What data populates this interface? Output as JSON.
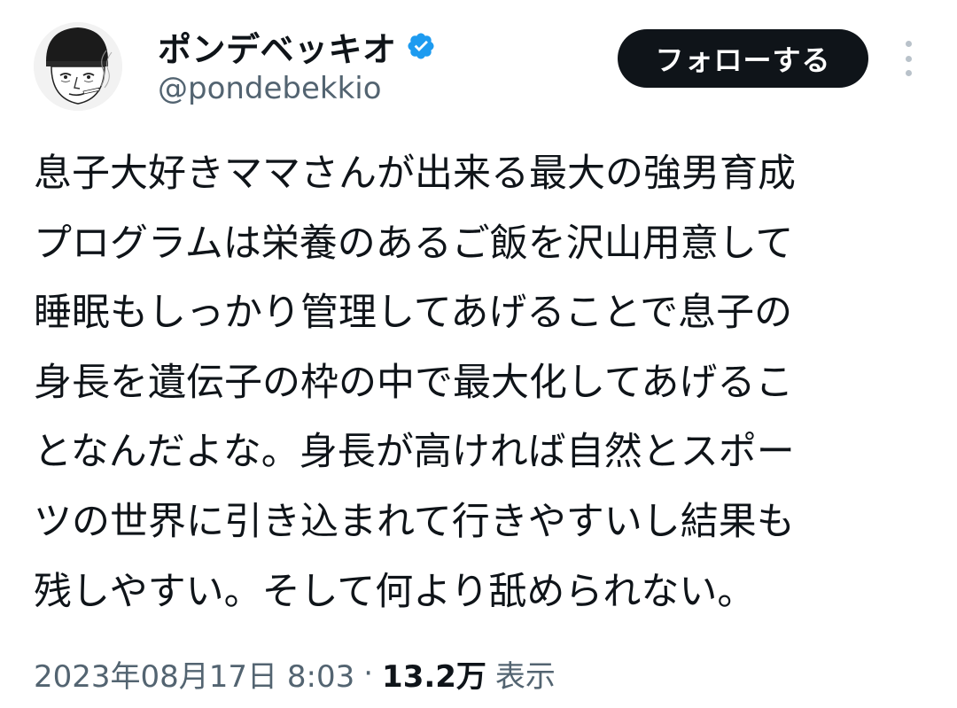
{
  "user": {
    "display_name": "ポンデベッキオ",
    "handle": "@pondebekkio",
    "verified": true,
    "verified_badge_color": "#1d9bf0"
  },
  "actions": {
    "follow_label": "フォローする",
    "more_icon": "more-vertical-icon"
  },
  "tweet": {
    "lines": [
      "息子大好きママさんが出来る最大の強男育成",
      "プログラムは栄養のあるご飯を沢山用意して",
      "睡眠もしっかり管理してあげることで息子の",
      "身長を遺伝子の枠の中で最大化してあげるこ",
      "となんだよな。身長が高ければ自然とスポー",
      "ツの世界に引き込まれて行きやすいし結果も",
      "残しやすい。そして何より舐められない。"
    ]
  },
  "meta": {
    "timestamp": "2023年08月17日 8:03",
    "separator": "·",
    "views_count": "13.2万",
    "views_label": "表示"
  },
  "colors": {
    "text_primary": "#0f1419",
    "text_secondary": "#536471",
    "button_bg": "#0f1419",
    "button_text": "#ffffff"
  }
}
